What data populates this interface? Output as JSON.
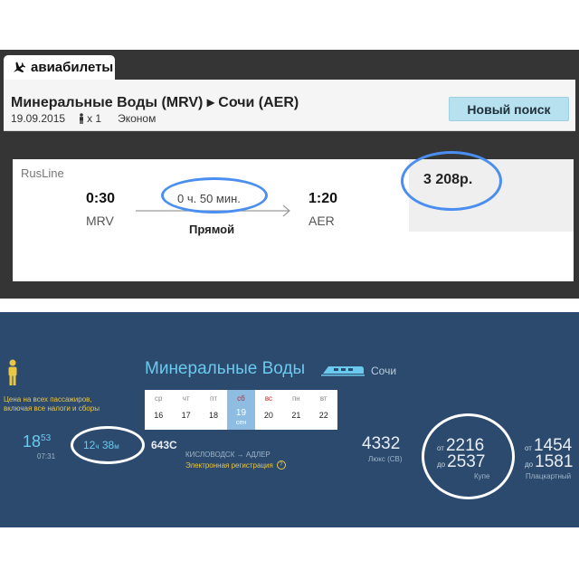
{
  "flights": {
    "tab_label": "авиабилеты",
    "route_title": "Минеральные Воды (MRV) ▸ Сочи (AER)",
    "date": "19.09.2015",
    "passengers": "x 1",
    "class": "Эконом",
    "new_search_label": "Новый поиск",
    "result": {
      "airline": "RusLine",
      "departure_time": "0:30",
      "departure_code": "MRV",
      "duration": "0 ч. 50 мин.",
      "stops": "Прямой",
      "arrival_time": "1:20",
      "arrival_code": "AER",
      "price": "3 208р."
    }
  },
  "trains": {
    "fare_note": "Цена на всех пассажиров, включая все налоги и сборы",
    "from_city": "Минеральные Воды",
    "to_city": "Сочи",
    "calendar": [
      {
        "dn": "ср",
        "dd": "16",
        "weekend": false,
        "selected": false
      },
      {
        "dn": "чт",
        "dd": "17",
        "weekend": false,
        "selected": false
      },
      {
        "dn": "пт",
        "dd": "18",
        "weekend": false,
        "selected": false
      },
      {
        "dn": "сб",
        "dd": "19",
        "weekend": true,
        "selected": true,
        "month": "сен"
      },
      {
        "dn": "вс",
        "dd": "20",
        "weekend": true,
        "selected": false
      },
      {
        "dn": "пн",
        "dd": "21",
        "weekend": false,
        "selected": false
      },
      {
        "dn": "вт",
        "dd": "22",
        "weekend": false,
        "selected": false
      }
    ],
    "departure_hours": "18",
    "departure_minutes": "53",
    "departure_sub": "07:31",
    "duration_hours": "12",
    "duration_h_unit": "ч",
    "duration_minutes": "38",
    "duration_m_unit": "м",
    "train_number": "643С",
    "train_route": "КИСЛОВОДСК → АДЛЕР",
    "e_registration": "Электронная регистрация",
    "help_glyph": "?",
    "lux_price": "4332",
    "lux_label": "Люкс (СВ)",
    "from_prefix": "от",
    "to_prefix": "до",
    "kupe_from": "2216",
    "kupe_to": "2537",
    "kupe_label": "Купе",
    "plac_from": "1454",
    "plac_to": "1581",
    "plac_label": "Плацкартный"
  },
  "colors": {
    "highlight_blue": "#4a8ff0",
    "train_panel": "#2c4a6e",
    "accent_cyan": "#6cc9ee",
    "accent_yellow": "#e9c645"
  },
  "icons": [
    "airplane-icon",
    "passenger-icon",
    "route-arrow-icon",
    "person-icon",
    "train-icon",
    "help-icon"
  ]
}
